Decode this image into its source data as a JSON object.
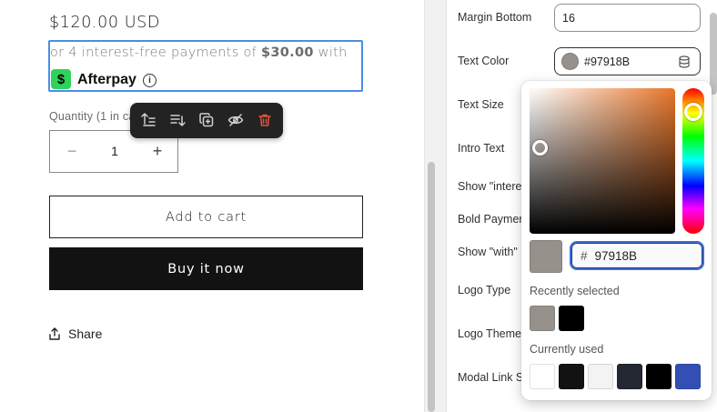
{
  "product": {
    "price": "$120.00 USD",
    "afterpay_prefix": "or 4 interest-free payments of ",
    "afterpay_amount": "$30.00",
    "afterpay_suffix": " with",
    "afterpay_logo_glyph": "$",
    "afterpay_name": "Afterpay",
    "afterpay_info_glyph": "i",
    "quantity_label": "Quantity (1 in ca",
    "quantity_value": "1",
    "minus_glyph": "−",
    "plus_glyph": "+",
    "add_to_cart": "Add to cart",
    "buy_now": "Buy it now",
    "share": "Share"
  },
  "block_toolbar": {
    "icons": [
      "move-up-icon",
      "move-down-icon",
      "duplicate-icon",
      "hide-icon",
      "delete-icon"
    ]
  },
  "settings": {
    "margin_bottom": {
      "label": "Margin Bottom",
      "value": "16"
    },
    "text_color": {
      "label": "Text Color",
      "value": "#97918B"
    },
    "text_size": {
      "label": "Text Size"
    },
    "intro_text": {
      "label": "Intro Text"
    },
    "show_interest": {
      "label": "Show \"intere"
    },
    "bold_payment": {
      "label": "Bold Paymen"
    },
    "show_with": {
      "label": "Show \"with\""
    },
    "logo_type": {
      "label": "Logo Type"
    },
    "logo_theme": {
      "label": "Logo Theme"
    },
    "modal_link": {
      "label": "Modal Link S"
    }
  },
  "color_picker": {
    "hex_hash": "#",
    "hex_value": "97918B",
    "hue_color": "#E8762A",
    "selected_color": "#97918B",
    "recently_selected_label": "Recently selected",
    "recently_selected": [
      "#97918B",
      "#000000"
    ],
    "currently_used_label": "Currently used",
    "currently_used": [
      "#FFFFFF",
      "#121212",
      "#F3F3F3",
      "#242833",
      "#000000",
      "#334FB4"
    ]
  },
  "colors": {
    "accent_focus": "#4A8EE6",
    "afterpay_green": "#2ED35A",
    "delete_red": "#E0533D"
  }
}
